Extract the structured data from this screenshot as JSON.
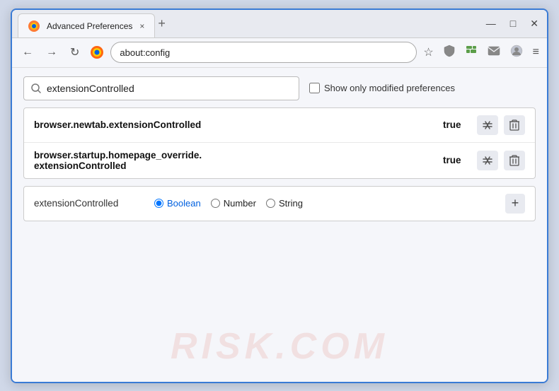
{
  "window": {
    "title": "Advanced Preferences",
    "tab_close": "×",
    "tab_new": "+",
    "controls": {
      "minimize": "—",
      "maximize": "□",
      "close": "✕"
    }
  },
  "navbar": {
    "back": "←",
    "forward": "→",
    "reload": "↻",
    "browser_name": "Firefox",
    "address": "about:config",
    "bookmark_icon": "☆",
    "shield_icon": "🛡",
    "extension_icon": "🧩",
    "mail_icon": "✉",
    "profile_icon": "◎",
    "menu_icon": "≡"
  },
  "search": {
    "placeholder": "extensionControlled",
    "value": "extensionControlled",
    "show_modified_label": "Show only modified preferences"
  },
  "results": [
    {
      "name": "browser.newtab.extensionControlled",
      "value": "true",
      "actions": [
        "edit",
        "delete"
      ]
    },
    {
      "name": "browser.startup.homepage_override.\nextensionControlled",
      "name_line1": "browser.startup.homepage_override.",
      "name_line2": "extensionControlled",
      "value": "true",
      "actions": [
        "edit",
        "delete"
      ]
    }
  ],
  "add_new": {
    "name": "extensionControlled",
    "types": [
      {
        "id": "boolean",
        "label": "Boolean",
        "checked": true
      },
      {
        "id": "number",
        "label": "Number",
        "checked": false
      },
      {
        "id": "string",
        "label": "String",
        "checked": false
      }
    ],
    "add_button": "+"
  },
  "watermark": "risk.com",
  "icons": {
    "search": "🔍",
    "edit": "⇄",
    "delete": "🗑",
    "plus": "+"
  }
}
